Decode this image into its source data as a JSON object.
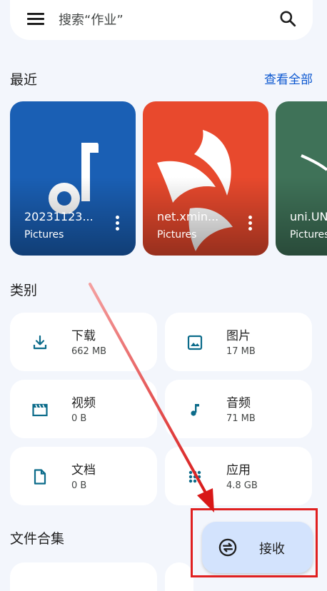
{
  "search": {
    "placeholder": "搜索“作业”"
  },
  "recent": {
    "title": "最近",
    "see_all": "查看全部",
    "items": [
      {
        "name": "20231123...",
        "folder": "Pictures",
        "bg": "#1a5fb4"
      },
      {
        "name": "net.xmin...",
        "folder": "Pictures",
        "bg": "#e8492d"
      },
      {
        "name": "uni.UN",
        "folder": "Pictures",
        "bg": "#3f7258"
      }
    ]
  },
  "categories": {
    "title": "类别",
    "items": [
      {
        "label": "下载",
        "size": "662 MB",
        "icon": "download-icon"
      },
      {
        "label": "图片",
        "size": "17 MB",
        "icon": "image-icon"
      },
      {
        "label": "视频",
        "size": "0 B",
        "icon": "movie-icon"
      },
      {
        "label": "音频",
        "size": "71 MB",
        "icon": "music-note-icon"
      },
      {
        "label": "文档",
        "size": "0 B",
        "icon": "document-icon"
      },
      {
        "label": "应用",
        "size": "4.8 GB",
        "icon": "apps-icon"
      }
    ]
  },
  "collections": {
    "title": "文件合集"
  },
  "fab": {
    "label": "接收",
    "icon": "receive-icon"
  },
  "colors": {
    "accent": "#0b57d0",
    "icon": "#0b6b8a",
    "highlight": "#e02020",
    "fab_bg": "#d3e3fd"
  }
}
